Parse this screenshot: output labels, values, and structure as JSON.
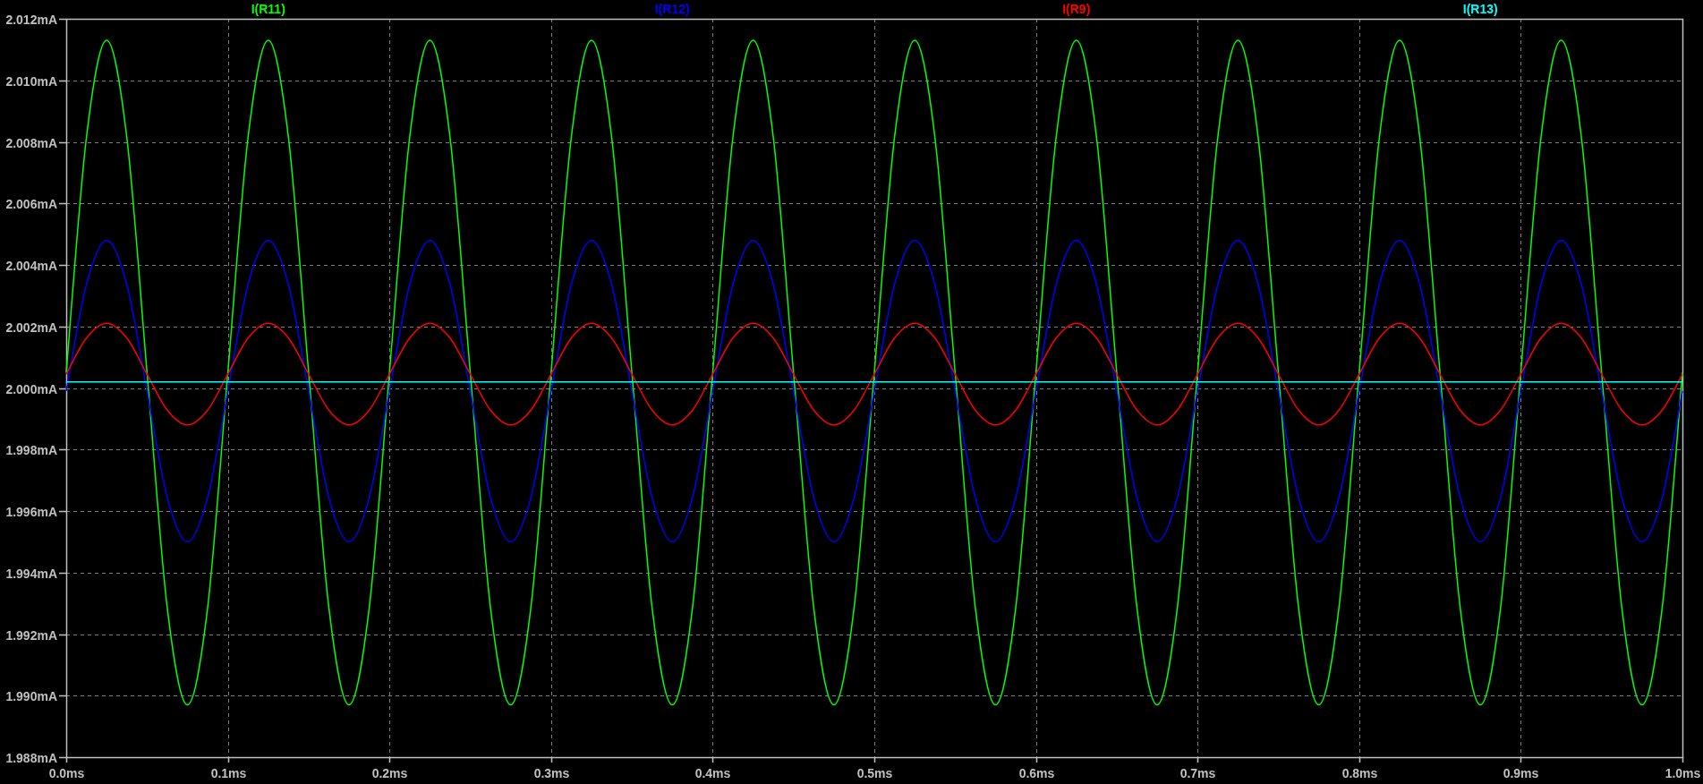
{
  "plot": {
    "chart_data": {
      "type": "line",
      "x": [
        0,
        0.0125,
        0.025,
        0.0375,
        0.05,
        0.0625,
        0.075,
        0.0875,
        0.1,
        0.1125,
        0.125,
        0.1375,
        0.15,
        0.1625,
        0.175,
        0.1875,
        0.2,
        0.2125,
        0.225,
        0.2375,
        0.25,
        0.2625,
        0.275,
        0.2875,
        0.3,
        0.3125,
        0.325,
        0.3375,
        0.35,
        0.3625,
        0.375,
        0.3875,
        0.4,
        0.4125,
        0.425,
        0.4375,
        0.45,
        0.4625,
        0.475,
        0.4875,
        0.5,
        0.5125,
        0.525,
        0.5375,
        0.55,
        0.5625,
        0.575,
        0.5875,
        0.6,
        0.6125,
        0.625,
        0.6375,
        0.65,
        0.6625,
        0.675,
        0.6875,
        0.7,
        0.7125,
        0.725,
        0.7375,
        0.75,
        0.7625,
        0.775,
        0.7875,
        0.8,
        0.8125,
        0.825,
        0.8375,
        0.85,
        0.8625,
        0.875,
        0.8875,
        0.9,
        0.9125,
        0.925,
        0.9375,
        0.95,
        0.9625,
        0.975,
        0.9875,
        1
      ],
      "series": [
        {
          "name": "I(R11)",
          "color": "#00ff00",
          "values": [
            2.0005,
            2.00814,
            2.0113,
            2.00814,
            2.0005,
            1.99286,
            1.9897,
            1.99286,
            2.0005,
            2.00814,
            2.0113,
            2.00814,
            2.0005,
            1.99286,
            1.9897,
            1.99286,
            2.0005,
            2.00814,
            2.0113,
            2.00814,
            2.0005,
            1.99286,
            1.9897,
            1.99286,
            2.0005,
            2.00814,
            2.0113,
            2.00814,
            2.0005,
            1.99286,
            1.9897,
            1.99286,
            2.0005,
            2.00814,
            2.0113,
            2.00814,
            2.0005,
            1.99286,
            1.9897,
            1.99286,
            2.0005,
            2.00814,
            2.0113,
            2.00814,
            2.0005,
            1.99286,
            1.9897,
            1.99286,
            2.0005,
            2.00814,
            2.0113,
            2.00814,
            2.0005,
            1.99286,
            1.9897,
            1.99286,
            2.0005,
            2.00814,
            2.0113,
            2.00814,
            2.0005,
            1.99286,
            1.9897,
            1.99286,
            2.0005,
            2.00814,
            2.0113,
            2.00814,
            2.0005,
            1.99286,
            1.9897,
            1.99286,
            2.0005,
            2.00814,
            2.0113,
            2.00814,
            2.0005,
            1.99286,
            1.9897,
            1.99286,
            2.0005
          ]
        },
        {
          "name": "I(R12)",
          "color": "#0000ff",
          "values": [
            1.9999,
            2.00336,
            2.0048,
            2.00336,
            1.9999,
            1.99644,
            1.995,
            1.99644,
            1.9999,
            2.00336,
            2.0048,
            2.00336,
            1.9999,
            1.99644,
            1.995,
            1.99644,
            1.9999,
            2.00336,
            2.0048,
            2.00336,
            1.9999,
            1.99644,
            1.995,
            1.99644,
            1.9999,
            2.00336,
            2.0048,
            2.00336,
            1.9999,
            1.99644,
            1.995,
            1.99644,
            1.9999,
            2.00336,
            2.0048,
            2.00336,
            1.9999,
            1.99644,
            1.995,
            1.99644,
            1.9999,
            2.00336,
            2.0048,
            2.00336,
            1.9999,
            1.99644,
            1.995,
            1.99644,
            1.9999,
            2.00336,
            2.0048,
            2.00336,
            1.9999,
            1.99644,
            1.995,
            1.99644,
            1.9999,
            2.00336,
            2.0048,
            2.00336,
            1.9999,
            1.99644,
            1.995,
            1.99644,
            1.9999,
            2.00336,
            2.0048,
            2.00336,
            1.9999,
            1.99644,
            1.995,
            1.99644,
            1.9999,
            2.00336,
            2.0048,
            2.00336,
            1.9999,
            1.99644,
            1.995,
            1.99644,
            1.9999
          ]
        },
        {
          "name": "I(R9)",
          "color": "#ff0000",
          "values": [
            2.00045,
            2.00162,
            2.0021,
            2.00162,
            2.00045,
            1.99928,
            1.9988,
            1.99928,
            2.00045,
            2.00162,
            2.0021,
            2.00162,
            2.00045,
            1.99928,
            1.9988,
            1.99928,
            2.00045,
            2.00162,
            2.0021,
            2.00162,
            2.00045,
            1.99928,
            1.9988,
            1.99928,
            2.00045,
            2.00162,
            2.0021,
            2.00162,
            2.00045,
            1.99928,
            1.9988,
            1.99928,
            2.00045,
            2.00162,
            2.0021,
            2.00162,
            2.00045,
            1.99928,
            1.9988,
            1.99928,
            2.00045,
            2.00162,
            2.0021,
            2.00162,
            2.00045,
            1.99928,
            1.9988,
            1.99928,
            2.00045,
            2.00162,
            2.0021,
            2.00162,
            2.00045,
            1.99928,
            1.9988,
            1.99928,
            2.00045,
            2.00162,
            2.0021,
            2.00162,
            2.00045,
            1.99928,
            1.9988,
            1.99928,
            2.00045,
            2.00162,
            2.0021,
            2.00162,
            2.00045,
            1.99928,
            1.9988,
            1.99928,
            2.00045,
            2.00162,
            2.0021,
            2.00162,
            2.00045,
            1.99928,
            1.9988,
            1.99928,
            2.00045
          ]
        },
        {
          "name": "I(R13)",
          "color": "#00ffff",
          "values": [
            2.0002,
            2.0002,
            2.0002,
            2.0002,
            2.0002,
            2.0002,
            2.0002,
            2.0002,
            2.0002,
            2.0002,
            2.0002,
            2.0002,
            2.0002,
            2.0002,
            2.0002,
            2.0002,
            2.0002,
            2.0002,
            2.0002,
            2.0002,
            2.0002,
            2.0002,
            2.0002,
            2.0002,
            2.0002,
            2.0002,
            2.0002,
            2.0002,
            2.0002,
            2.0002,
            2.0002,
            2.0002,
            2.0002,
            2.0002,
            2.0002,
            2.0002,
            2.0002,
            2.0002,
            2.0002,
            2.0002,
            2.0002,
            2.0002,
            2.0002,
            2.0002,
            2.0002,
            2.0002,
            2.0002,
            2.0002,
            2.0002,
            2.0002,
            2.0002,
            2.0002,
            2.0002,
            2.0002,
            2.0002,
            2.0002,
            2.0002,
            2.0002,
            2.0002,
            2.0002,
            2.0002,
            2.0002,
            2.0002,
            2.0002,
            2.0002,
            2.0002,
            2.0002,
            2.0002,
            2.0002,
            2.0002,
            2.0002,
            2.0002,
            2.0002,
            2.0002,
            2.0002,
            2.0002,
            2.0002,
            2.0002,
            2.0002,
            2.0002,
            2.0002
          ]
        }
      ],
      "grid": true,
      "xlim": [
        0,
        1
      ],
      "ylim": [
        1.988,
        2.012
      ],
      "xticks": [
        {
          "value": 0,
          "label": "0.0ms"
        },
        {
          "value": 0.1,
          "label": "0.1ms"
        },
        {
          "value": 0.2,
          "label": "0.2ms"
        },
        {
          "value": 0.3,
          "label": "0.3ms"
        },
        {
          "value": 0.4,
          "label": "0.4ms"
        },
        {
          "value": 0.5,
          "label": "0.5ms"
        },
        {
          "value": 0.6,
          "label": "0.6ms"
        },
        {
          "value": 0.7,
          "label": "0.7ms"
        },
        {
          "value": 0.8,
          "label": "0.8ms"
        },
        {
          "value": 0.9,
          "label": "0.9ms"
        },
        {
          "value": 1,
          "label": "1.0ms"
        }
      ],
      "yticks": [
        {
          "value": 1.988,
          "label": "1.988mA"
        },
        {
          "value": 1.99,
          "label": "1.990mA"
        },
        {
          "value": 1.992,
          "label": "1.992mA"
        },
        {
          "value": 1.994,
          "label": "1.994mA"
        },
        {
          "value": 1.996,
          "label": "1.996mA"
        },
        {
          "value": 1.998,
          "label": "1.998mA"
        },
        {
          "value": 2.0,
          "label": "2.000mA"
        },
        {
          "value": 2.002,
          "label": "2.002mA"
        },
        {
          "value": 2.004,
          "label": "2.004mA"
        },
        {
          "value": 2.006,
          "label": "2.006mA"
        },
        {
          "value": 2.008,
          "label": "2.008mA"
        },
        {
          "value": 2.01,
          "label": "2.010mA"
        },
        {
          "value": 2.012,
          "label": "2.012mA"
        }
      ]
    }
  }
}
